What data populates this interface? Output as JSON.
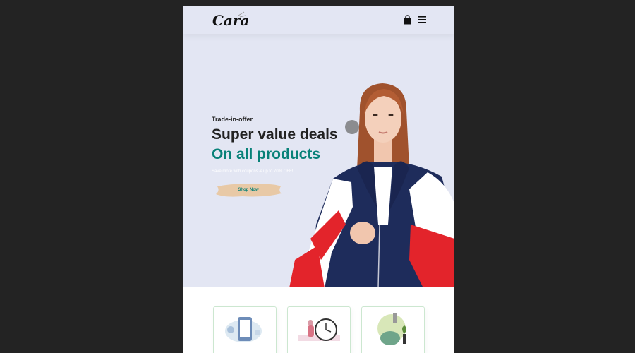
{
  "header": {
    "logo_text": "Cara"
  },
  "hero": {
    "kicker": "Trade-in-offer",
    "headline": "Super value deals",
    "highlight": "On all products",
    "subtext": "Save more with coupons & up to 70% OFF!",
    "cta_label": "Shop Now"
  },
  "colors": {
    "hero_bg": "#e3e6f3",
    "accent": "#088178",
    "button_brush": "#e8c9a6",
    "page_bg": "#232323"
  },
  "icons": {
    "cart": "shopping-bag-icon",
    "menu": "hamburger-menu-icon"
  },
  "features": [
    {
      "illustration": "online-order-illustration"
    },
    {
      "illustration": "save-time-illustration"
    },
    {
      "illustration": "save-money-illustration"
    }
  ]
}
